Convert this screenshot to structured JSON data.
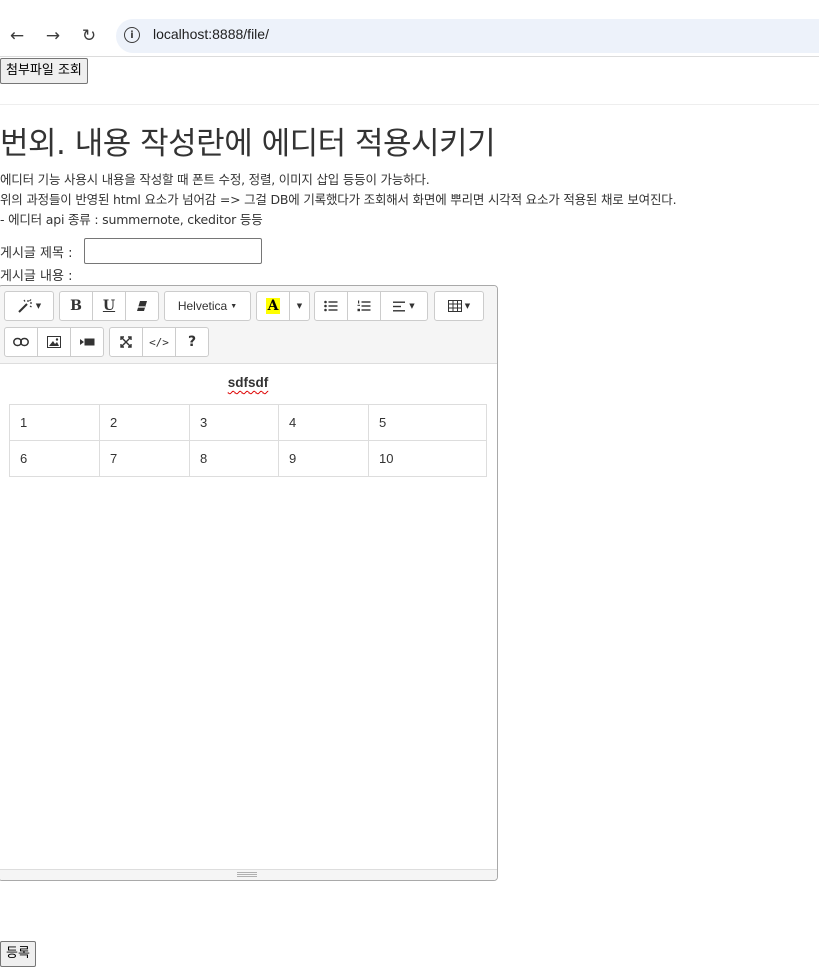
{
  "browser": {
    "url": "localhost:8888/file/",
    "back_glyph": "←",
    "forward_glyph": "→",
    "reload_glyph": "↻",
    "info_glyph": "i"
  },
  "page": {
    "attach_button": "첨부파일 조회",
    "title": "번외. 내용 작성란에 에디터 적용시키기",
    "desc_lines": [
      "에디터 기능 사용시 내용을 작성할 때 폰트 수정, 정렬, 이미지 삽입 등등이 가능하다.",
      "위의 과정들이 반영된 html 요소가 넘어감 => 그걸 DB에 기록했다가 조회해서 화면에 뿌리면 시각적 요소가 적용된 채로 보여진다.",
      "- 에디터 api 종류 : summernote, ckeditor 등등"
    ],
    "title_label": "게시글 제목 :",
    "title_value": "",
    "content_label": "게시글 내용 :",
    "submit_button": "등록"
  },
  "editor": {
    "font_name": "Helvetica",
    "color_letter": "A",
    "help_glyph": "?",
    "code_glyph": "</>",
    "bold_glyph": "B",
    "underline_glyph": "U",
    "content_text": "sdfsdf",
    "table": [
      [
        "1",
        "2",
        "3",
        "4",
        "5"
      ],
      [
        "6",
        "7",
        "8",
        "9",
        "10"
      ]
    ],
    "highlight_color": "#ffff00"
  }
}
